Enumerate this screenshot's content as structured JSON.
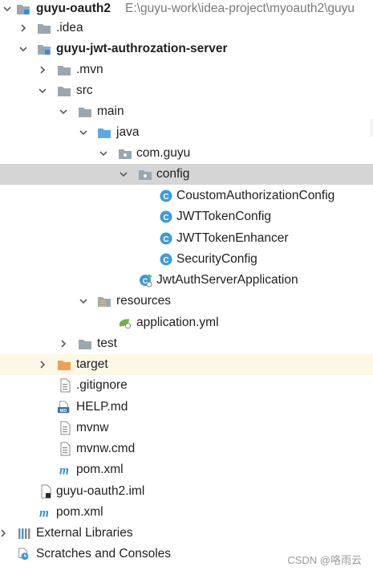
{
  "project_tree": {
    "root": {
      "name": "guyu-oauth2",
      "path": "E:\\guyu-work\\idea-project\\myoauth2\\guyu"
    },
    "items": [
      {
        "label": ".idea"
      },
      {
        "label": "guyu-jwt-authrozation-server"
      },
      {
        "label": ".mvn"
      },
      {
        "label": "src"
      },
      {
        "label": "main"
      },
      {
        "label": "java"
      },
      {
        "label": "com.guyu"
      },
      {
        "label": "config"
      },
      {
        "label": "CoustomAuthorizationConfig"
      },
      {
        "label": "JWTTokenConfig"
      },
      {
        "label": "JWTTokenEnhancer"
      },
      {
        "label": "SecurityConfig"
      },
      {
        "label": "JwtAuthServerApplication"
      },
      {
        "label": "resources"
      },
      {
        "label": "application.yml"
      },
      {
        "label": "test"
      },
      {
        "label": "target"
      },
      {
        "label": ".gitignore"
      },
      {
        "label": "HELP.md"
      },
      {
        "label": "mvnw"
      },
      {
        "label": "mvnw.cmd"
      },
      {
        "label": "pom.xml"
      },
      {
        "label": "guyu-oauth2.iml"
      },
      {
        "label": "pom.xml"
      },
      {
        "label": "External Libraries"
      },
      {
        "label": "Scratches and Consoles"
      }
    ]
  },
  "icons": {
    "md_badge": "MD",
    "maven_badge": "m",
    "class_badge": "C"
  },
  "colors": {
    "selected_row": "#d5d5d5",
    "highlight_row": "#fdf8e6",
    "folder": "#9aa7b0",
    "source_folder": "#5fa9e3",
    "class_icon": "#3e9bd6",
    "target_folder": "#f0a050",
    "module_blue": "#2f8fd8"
  },
  "watermark": "CSDN @咯雨云"
}
